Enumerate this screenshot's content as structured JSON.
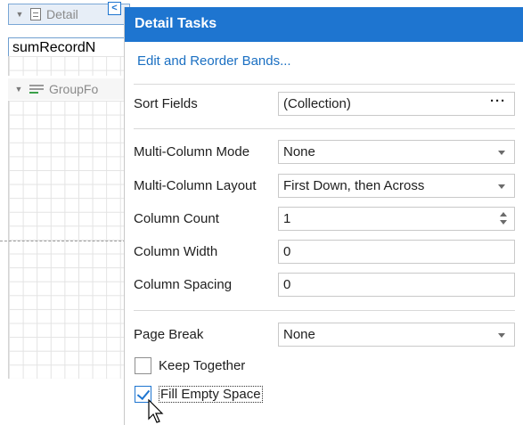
{
  "designer": {
    "detail_band_label": "Detail",
    "field_text": "sumRecordN",
    "group_footer_label": "GroupFo",
    "collapse_glyph": "<"
  },
  "panel": {
    "title": "Detail Tasks",
    "edit_bands_link": "Edit and Reorder Bands...",
    "sort_fields": {
      "label": "Sort Fields",
      "value": "(Collection)",
      "button": "···"
    },
    "multi_column_mode": {
      "label": "Multi-Column Mode",
      "value": "None"
    },
    "multi_column_layout": {
      "label": "Multi-Column Layout",
      "value": "First Down, then Across"
    },
    "column_count": {
      "label": "Column Count",
      "value": "1"
    },
    "column_width": {
      "label": "Column Width",
      "value": "0"
    },
    "column_spacing": {
      "label": "Column Spacing",
      "value": "0"
    },
    "page_break": {
      "label": "Page Break",
      "value": "None"
    },
    "keep_together": {
      "label": "Keep Together",
      "checked": false
    },
    "fill_empty_space": {
      "label": "Fill Empty Space",
      "checked": true
    }
  },
  "colors": {
    "accent": "#1e75d0",
    "link": "#1a6fc2"
  },
  "icons": [
    "expand-arrow-icon",
    "document-icon",
    "group-footer-icon",
    "dropdown-caret-icon",
    "spin-icon",
    "mouse-pointer-icon"
  ]
}
